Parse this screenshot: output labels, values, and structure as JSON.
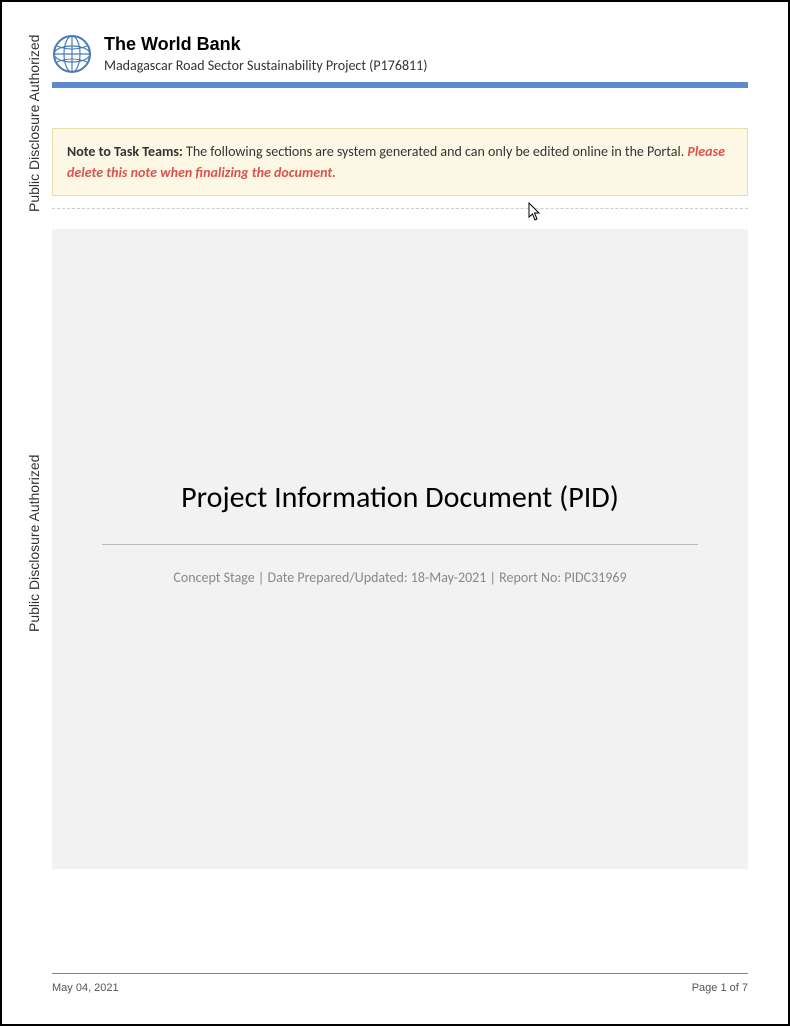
{
  "watermark": "Public Disclosure Authorized",
  "header": {
    "org": "The World Bank",
    "project": "Madagascar Road Sector Sustainability Project (P176811)"
  },
  "note": {
    "lead": "Note to Task Teams:",
    "body": " The following sections are system generated and can only be edited online in the Portal. ",
    "warn": "Please delete this note when finalizing the document."
  },
  "main": {
    "title": "Project Information Document (PID)",
    "meta": "Concept Stage | Date Prepared/Updated: 18-May-2021 | Report No: PIDC31969"
  },
  "footer": {
    "date": "May 04, 2021",
    "page": "Page 1 of 7"
  }
}
